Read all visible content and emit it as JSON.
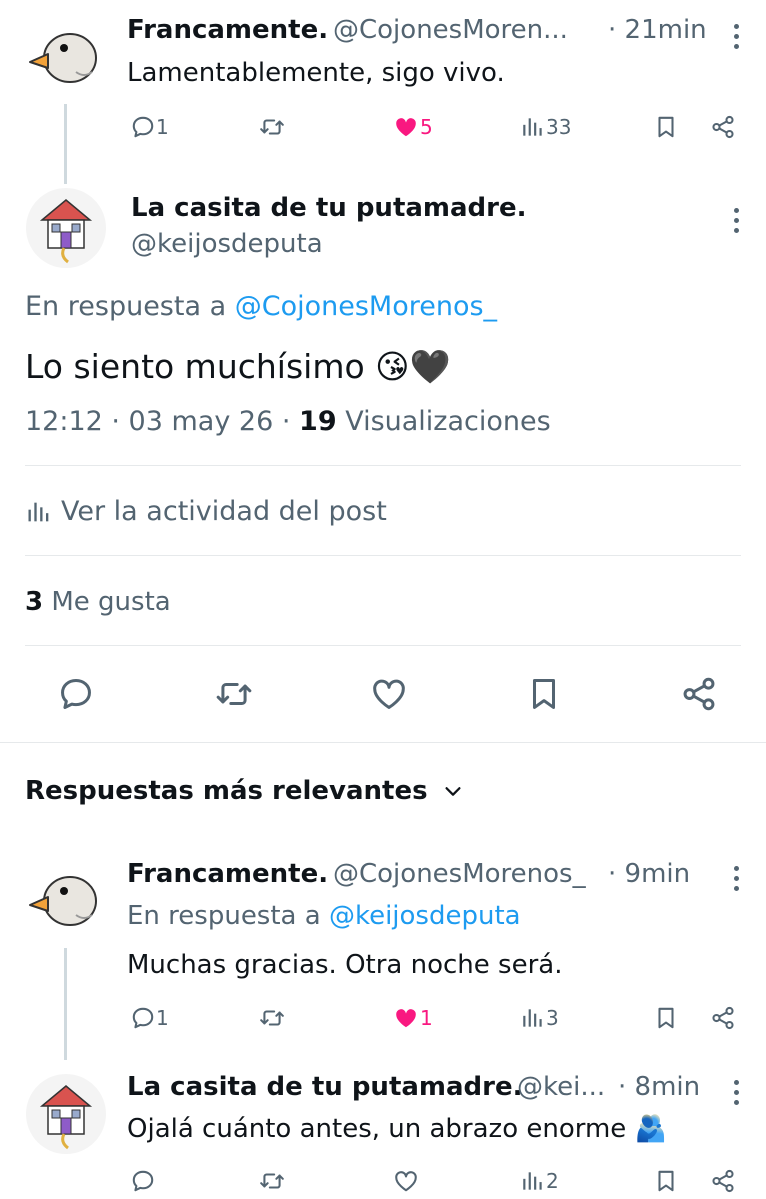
{
  "tweet1": {
    "name": "Francamente.",
    "handle": "@CojonesMoren...",
    "time": "· 21min",
    "text": "Lamentablemente, sigo vivo.",
    "replies": "1",
    "likes": "5",
    "views": "33"
  },
  "main": {
    "name": "La casita de tu putamadre.",
    "handle": "@keijosdeputa",
    "reply_prefix": "En respuesta a",
    "reply_to": "@CojonesMorenos_",
    "text": "Lo siento muchísimo 😘🖤",
    "meta_time": "12:12 · 03 may 26 ·",
    "views_count": "19",
    "views_label": "Visualizaciones",
    "activity_label": "Ver la actividad del post",
    "likes_count": "3",
    "likes_label": "Me gusta"
  },
  "sort": {
    "label": "Respuestas más relevantes"
  },
  "reply1": {
    "name": "Francamente.",
    "handle": "@CojonesMorenos_",
    "time": "· 9min",
    "reply_prefix": "En respuesta a",
    "reply_to": "@keijosdeputa",
    "text": "Muchas gracias. Otra noche será.",
    "replies": "1",
    "likes": "1",
    "views": "3"
  },
  "reply2": {
    "name": "La casita de tu putamadre.",
    "handle": "@kei...",
    "time": "· 8min",
    "text": "Ojalá cuánto antes, un abrazo enorme 🫂",
    "views": "2"
  },
  "colors": {
    "accent": "#1d9bf0",
    "like": "#f91880",
    "muted": "#536471"
  }
}
